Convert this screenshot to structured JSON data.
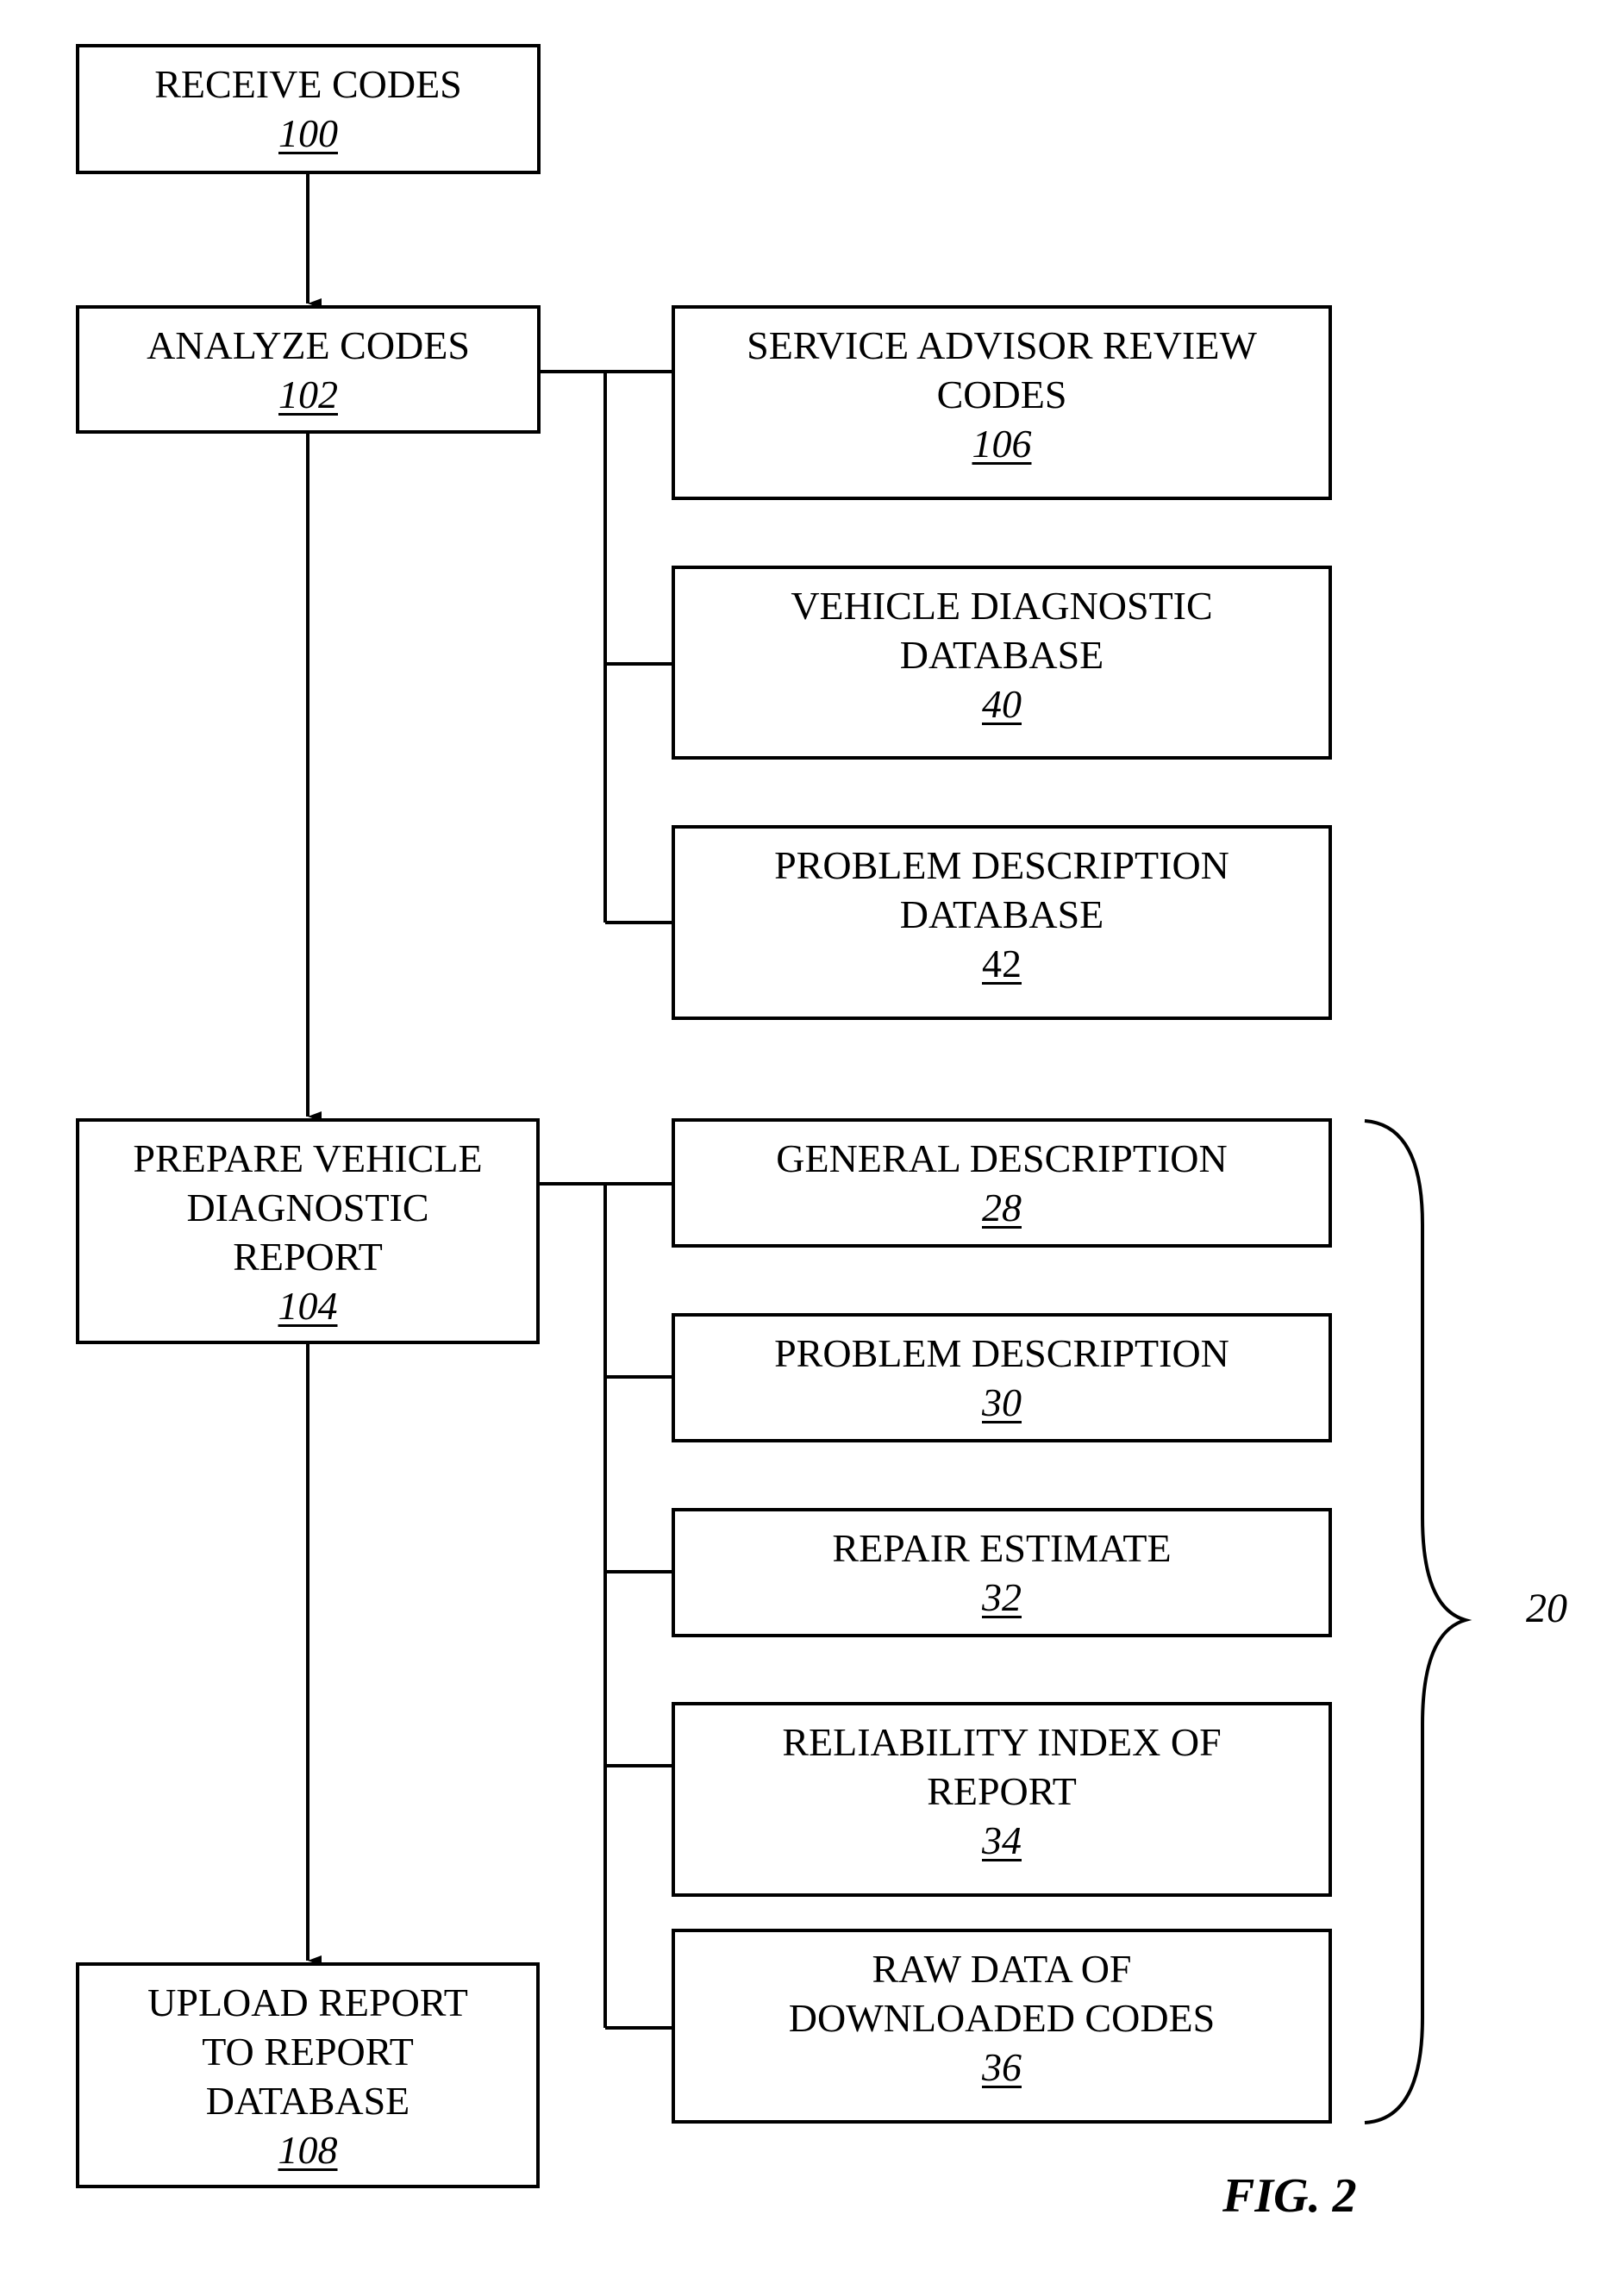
{
  "figure": {
    "title": "FIG. 2",
    "group_label": "20",
    "flow": [
      {
        "id": "receive",
        "lines": [
          "RECEIVE CODES"
        ],
        "ref": "100"
      },
      {
        "id": "analyze",
        "lines": [
          "ANALYZE CODES"
        ],
        "ref": "102"
      },
      {
        "id": "prepare",
        "lines": [
          "PREPARE VEHICLE",
          "DIAGNOSTIC",
          "REPORT"
        ],
        "ref": "104"
      },
      {
        "id": "upload",
        "lines": [
          "UPLOAD REPORT",
          "TO REPORT",
          "DATABASE"
        ],
        "ref": "108"
      }
    ],
    "analyze_branches": [
      {
        "id": "service-advisor",
        "lines": [
          "SERVICE ADVISOR REVIEW",
          "CODES"
        ],
        "ref": "106"
      },
      {
        "id": "vehicle-diagnostic-db",
        "lines": [
          "VEHICLE DIAGNOSTIC",
          "DATABASE"
        ],
        "ref": "40"
      },
      {
        "id": "problem-description-db",
        "lines": [
          "PROBLEM DESCRIPTION",
          "DATABASE"
        ],
        "ref": "42"
      }
    ],
    "report_components": [
      {
        "id": "general-description",
        "lines": [
          "GENERAL DESCRIPTION"
        ],
        "ref": "28"
      },
      {
        "id": "problem-description",
        "lines": [
          "PROBLEM DESCRIPTION"
        ],
        "ref": "30"
      },
      {
        "id": "repair-estimate",
        "lines": [
          "REPAIR ESTIMATE"
        ],
        "ref": "32"
      },
      {
        "id": "reliability-index",
        "lines": [
          "RELIABILITY INDEX OF",
          "REPORT"
        ],
        "ref": "34"
      },
      {
        "id": "raw-data",
        "lines": [
          "RAW DATA OF",
          "DOWNLOADED CODES"
        ],
        "ref": "36"
      }
    ]
  }
}
